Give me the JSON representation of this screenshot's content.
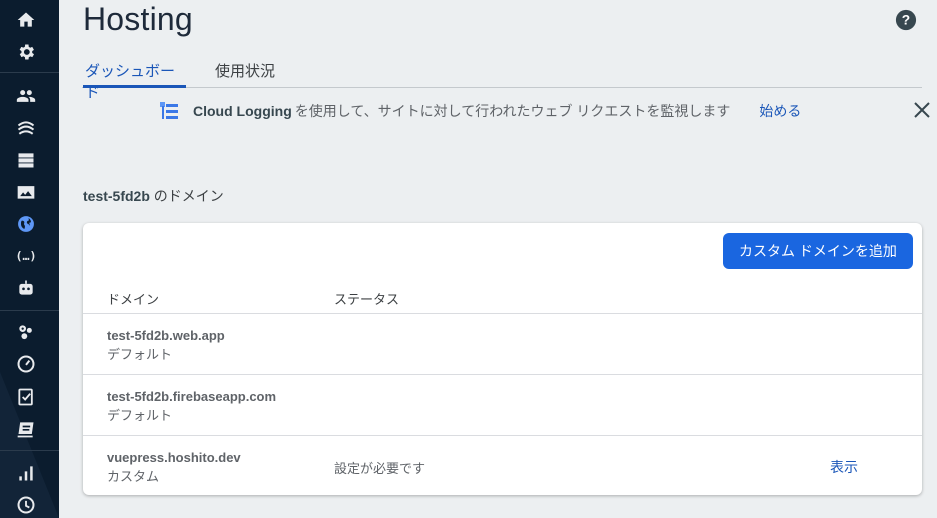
{
  "sidebar": {
    "icons": [
      "home-icon",
      "settings-icon",
      "users-icon",
      "hosting-wave-icon",
      "database-icon",
      "image-storage-icon",
      "globe-icon",
      "functions-icon",
      "robot-icon",
      "settings-gear-cluster-icon",
      "speedometer-icon",
      "checklist-icon",
      "test-lab-icon",
      "analytics-bar-icon",
      "clock-icon"
    ],
    "active": "globe-icon"
  },
  "header": {
    "title": "Hosting",
    "help_icon": "help-icon"
  },
  "tabs": [
    {
      "label": "ダッシュボード",
      "active": true
    },
    {
      "label": "使用状況",
      "active": false
    }
  ],
  "banner": {
    "brand": "Cloud Logging",
    "text": " を使用して、サイトに対して行われたウェブ リクエストを監視します",
    "action": "始める",
    "close_icon": "close-icon"
  },
  "domains_section": {
    "project": "test-5fd2b",
    "suffix": " のドメイン",
    "add_button": "カスタム ドメインを追加",
    "columns": [
      "ドメイン",
      "ステータス"
    ],
    "rows": [
      {
        "domain": "test-5fd2b.web.app",
        "type": "デフォルト",
        "status": "",
        "action": ""
      },
      {
        "domain": "test-5fd2b.firebaseapp.com",
        "type": "デフォルト",
        "status": "",
        "action": ""
      },
      {
        "domain": "vuepress.hoshito.dev",
        "type": "カスタム",
        "status": "設定が必要です",
        "action": "表示"
      }
    ]
  },
  "colors": {
    "sidebar_bg": "#0b1c2e",
    "accent": "#1a56b8",
    "button": "#1a66e0",
    "page_bg": "#eceff1"
  }
}
